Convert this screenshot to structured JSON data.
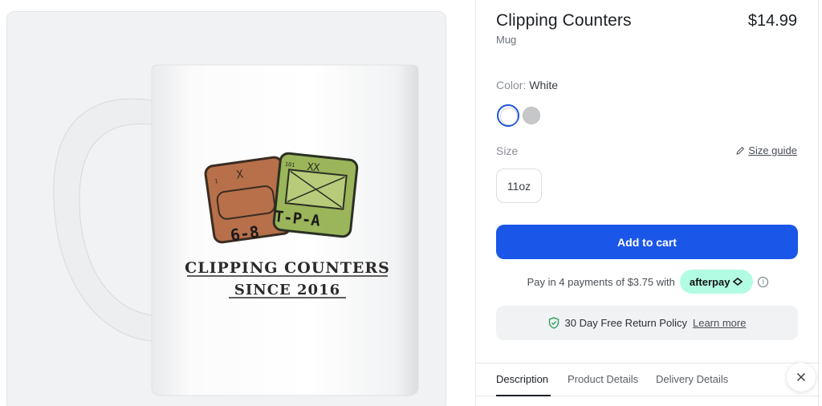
{
  "product": {
    "title": "Clipping Counters",
    "type": "Mug",
    "price": "$14.99"
  },
  "mug_print": {
    "line1": "CLIPPING COUNTERS",
    "line2": "SINCE 2016",
    "counter_left_label": "6-8",
    "counter_left_number": "1",
    "counter_right_label": "T-P-A",
    "counter_right_number": "101"
  },
  "color": {
    "label": "Color:",
    "selected": "White",
    "options": [
      {
        "name": "White",
        "hex": "#ffffff"
      },
      {
        "name": "Gray",
        "hex": "#c6c7c9"
      }
    ]
  },
  "size": {
    "label": "Size",
    "guide_label": "Size guide",
    "options": [
      "11oz"
    ]
  },
  "cart": {
    "button_label": "Add to cart",
    "button_color": "#1a56e8"
  },
  "afterpay": {
    "text": "Pay in 4 payments of $3.75 with",
    "badge": "afterpay",
    "badge_color": "#b2fce4"
  },
  "returns": {
    "text": "30 Day Free Return Policy",
    "link": "Learn more"
  },
  "tabs": [
    "Description",
    "Product Details",
    "Delivery Details"
  ],
  "active_tab": "Description",
  "icons": {
    "pencil": "pencil-icon",
    "shield": "shield-check-icon",
    "info": "info-icon",
    "close": "close-icon"
  }
}
